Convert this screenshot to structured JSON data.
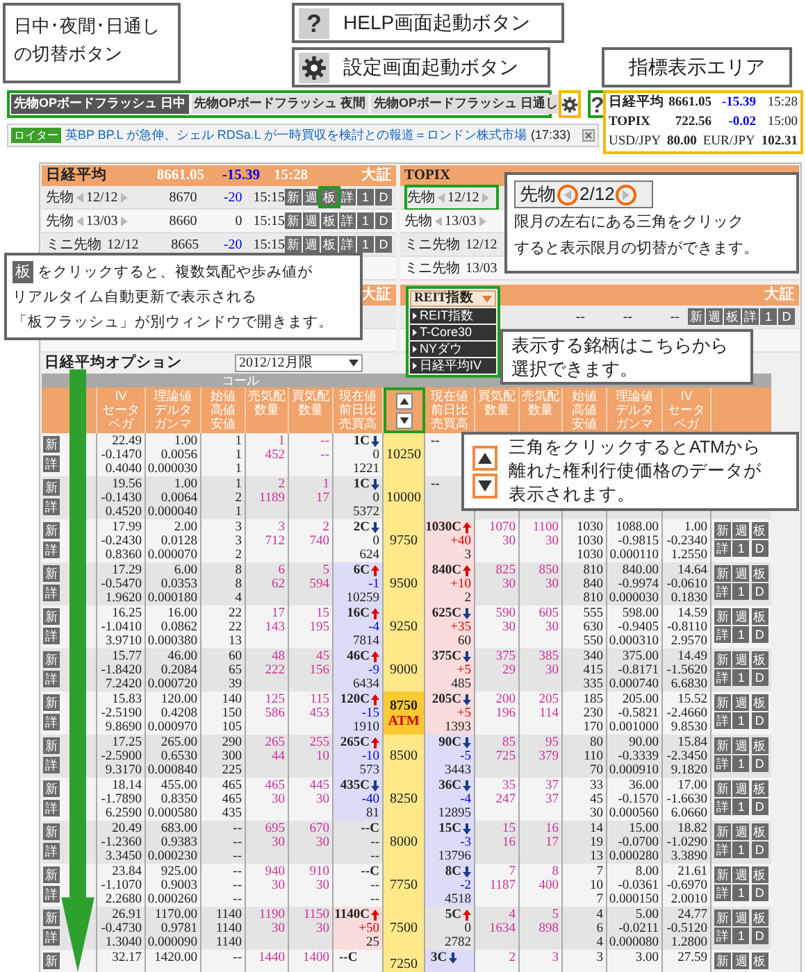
{
  "callouts": {
    "tab_switch": [
      "日中･夜間･日通し",
      "の切替ボタン"
    ],
    "help": {
      "icon": "?",
      "text": "HELP画面起動ボタン"
    },
    "settings": "設定画面起動ボタン",
    "indicators": "指標表示エリア",
    "board": {
      "badge": "板",
      "lines": [
        "をクリックすると、複数気配や歩み値が",
        "リアルタイム自動更新で表示される",
        "「板フラッシュ」が別ウィンドウで開きます。"
      ]
    },
    "month": {
      "label": "先物",
      "month": "2/12",
      "lines": [
        "限月の左右にある三角をクリック",
        "すると表示限月の切替ができます。"
      ]
    },
    "symbol": [
      "表示する銘柄はこちらから",
      "選択できます。"
    ],
    "strike": [
      "三角をクリックするとATMから",
      "離れた権利行使価格のデータが",
      "表示されます。"
    ]
  },
  "tabs_bar": {
    "highlighted": true,
    "color": "#1e9e1e",
    "tabs": [
      {
        "label": "先物OPボードフラッシュ 日中",
        "selected": true
      },
      {
        "label": "先物OPボードフラッシュ 夜間",
        "selected": false
      },
      {
        "label": "先物OPボードフラッシュ 日通し",
        "selected": false
      }
    ]
  },
  "settings_button": {
    "highlighted": true,
    "color": "#f5b800"
  },
  "help_button": {
    "label": "?",
    "highlighted": true,
    "color": "#1e9e1e"
  },
  "indicator_panel": {
    "highlighted": true,
    "color": "#f5b800",
    "indices": [
      {
        "name": "日経平均",
        "value": "8661.05",
        "change": "-15.39",
        "time": "15:28"
      },
      {
        "name": "TOPIX",
        "value": "722.56",
        "change": "-0.02",
        "time": "15:00"
      }
    ],
    "fx": [
      {
        "pair": "USD/JPY",
        "value": "80.00"
      },
      {
        "pair": "EUR/JPY",
        "value": "102.31"
      }
    ]
  },
  "news": {
    "source": "ロイター",
    "headline": "英BP BP.L が急伸、シェル RDSa.L が一時買収を検討との報道＝ロンドン株式市場",
    "time": "(17:33)"
  },
  "nikkei_panel": {
    "header": {
      "name": "日経平均",
      "value": "8661.05",
      "change": "-15.39",
      "time": "15:28",
      "exchange": "大証"
    },
    "rows": [
      {
        "name": "先物",
        "month": "12/12",
        "price": "8670",
        "change": "-20",
        "time": "15:15",
        "buttons": [
          "新",
          "週",
          "板",
          "詳",
          "1",
          "D"
        ],
        "highlighted": true,
        "color": "#1e9e1e"
      },
      {
        "name": "先物",
        "month": "13/03",
        "price": "8660",
        "change": "0",
        "time": "15:15",
        "buttons": [
          "新",
          "週",
          "板",
          "詳",
          "1",
          "D"
        ],
        "highlighted": false
      },
      {
        "name": "ミニ先物",
        "month": "12/12",
        "price": "8665",
        "change": "-20",
        "time": "15:15",
        "buttons": [
          "新",
          "週",
          "板",
          "詳",
          "1",
          "D"
        ],
        "highlighted": false
      }
    ]
  },
  "nikkei_panel_2": {
    "exchange": "大証"
  },
  "topix_panel": {
    "header": {
      "name": "TOPIX"
    },
    "rows": [
      {
        "name": "先物",
        "month": "12/12",
        "highlighted": true,
        "color": "#1e9e1e"
      },
      {
        "name": "先物",
        "month": "13/03",
        "highlighted": false
      },
      {
        "name": "ミニ先物",
        "month": "12/12",
        "highlighted": false
      },
      {
        "name": "ミニ先物",
        "month": "13/03",
        "highlighted": false
      }
    ]
  },
  "reit_panel": {
    "dropdown": "REIT指数",
    "highlighted": true,
    "color": "#1e9e1e",
    "menu": [
      "REIT指数",
      "T-Core30",
      "NYダウ",
      "日経平均IV"
    ],
    "exchange": "大証",
    "values": [
      "--",
      "--",
      "--"
    ],
    "buttons": [
      "新",
      "週",
      "板",
      "詳",
      "1",
      "D"
    ]
  },
  "options": {
    "title": "日経平均オプション",
    "month_select": "2012/12月限",
    "call_header": "コール",
    "strike_nav": {
      "highlighted": true,
      "color": "#1e9e1e"
    },
    "call_columns": [
      [
        "IV",
        "セータ",
        "ベガ"
      ],
      [
        "理論値",
        "デルタ",
        "ガンマ"
      ],
      [
        "始値",
        "高値",
        "安値"
      ],
      [
        "売気配",
        "数量"
      ],
      [
        "買気配",
        "数量"
      ],
      [
        "現在値",
        "前日比",
        "売買高"
      ]
    ],
    "put_columns": [
      [
        "現在値",
        "前日比",
        "売買高"
      ],
      [
        "買気配",
        "数量"
      ],
      [
        "売気配",
        "数量"
      ],
      [
        "始値",
        "高値",
        "安値"
      ],
      [
        "理論値",
        "デルタ",
        "ガンマ"
      ],
      [
        "IV",
        "セータ",
        "ベガ"
      ]
    ],
    "rows": [
      {
        "strike": "10250",
        "atm": false,
        "call_buttons": [
          "新",
          "詳"
        ],
        "call": {
          "iv": [
            "22.49",
            "-0.1470",
            "0.4040"
          ],
          "theo": [
            "1.00",
            "0.0056",
            "0.000030"
          ],
          "ohl": [
            "1",
            "1",
            "1"
          ],
          "ask": [
            "1",
            "452"
          ],
          "bid": [
            "--",
            "--"
          ],
          "cur": {
            "price": "1C",
            "kind": "down",
            "change": "0",
            "volume": "1221"
          }
        },
        "put": {
          "cur": {
            "price": "--"
          }
        }
      },
      {
        "strike": "10000",
        "atm": false,
        "call_buttons": [
          "新",
          "詳"
        ],
        "call": {
          "iv": [
            "19.56",
            "-0.1430",
            "0.4520"
          ],
          "theo": [
            "1.00",
            "0.0064",
            "0.000040"
          ],
          "ohl": [
            "1",
            "2",
            "1"
          ],
          "ask": [
            "2",
            "1189"
          ],
          "bid": [
            "1",
            "17"
          ],
          "cur": {
            "price": "1C",
            "kind": "down",
            "change": "0",
            "volume": "5372"
          }
        },
        "put": {
          "cur": {
            "price": "--"
          }
        }
      },
      {
        "strike": "9750",
        "atm": false,
        "call_buttons": [
          "新",
          "詳"
        ],
        "put_buttons": [
          "新",
          "週",
          "板",
          "詳",
          "1",
          "D"
        ],
        "call": {
          "iv": [
            "17.99",
            "-0.2430",
            "0.8360"
          ],
          "theo": [
            "2.00",
            "0.0128",
            "0.000070"
          ],
          "ohl": [
            "3",
            "3",
            "2"
          ],
          "ask": [
            "3",
            "712"
          ],
          "bid": [
            "2",
            "740"
          ],
          "cur": {
            "price": "2C",
            "kind": "down",
            "change": "0",
            "volume": "624"
          }
        },
        "put": {
          "cur": {
            "price": "1030C",
            "kind": "up",
            "change": "+40",
            "volume": "3",
            "color": "#fadcdc"
          },
          "bid": [
            "1070",
            "30"
          ],
          "ask": [
            "1100",
            "30"
          ],
          "ohl": [
            "1030",
            "1030",
            "1030"
          ],
          "theo": [
            "1088.00",
            "-0.9815",
            "0.000110"
          ],
          "iv": [
            "1.00",
            "-0.2340",
            "1.2550"
          ]
        }
      },
      {
        "strike": "9500",
        "atm": false,
        "call_buttons": [
          "新",
          "詳"
        ],
        "put_buttons": [
          "新",
          "週",
          "板",
          "詳",
          "1",
          "D"
        ],
        "call": {
          "iv": [
            "17.29",
            "-0.5470",
            "1.9620"
          ],
          "theo": [
            "6.00",
            "0.0353",
            "0.000180"
          ],
          "ohl": [
            "8",
            "8",
            "4"
          ],
          "ask": [
            "6",
            "62"
          ],
          "bid": [
            "5",
            "594"
          ],
          "cur": {
            "price": "6C",
            "kind": "up",
            "change": "-1",
            "volume": "10259",
            "color": "#dcdcf8"
          }
        },
        "put": {
          "cur": {
            "price": "840C",
            "kind": "up",
            "change": "+10",
            "volume": "2",
            "color": "#fadcdc"
          },
          "bid": [
            "825",
            "30"
          ],
          "ask": [
            "850",
            "30"
          ],
          "ohl": [
            "810",
            "840",
            "810"
          ],
          "theo": [
            "840.00",
            "-0.9974",
            "0.000030"
          ],
          "iv": [
            "14.64",
            "-0.0610",
            "0.1830"
          ]
        }
      },
      {
        "strike": "9250",
        "atm": false,
        "call_buttons": [
          "新",
          "詳"
        ],
        "put_buttons": [
          "新",
          "週",
          "板",
          "詳",
          "1",
          "D"
        ],
        "call": {
          "iv": [
            "16.25",
            "-1.0410",
            "3.9710"
          ],
          "theo": [
            "16.00",
            "0.0862",
            "0.000380"
          ],
          "ohl": [
            "22",
            "22",
            "13"
          ],
          "ask": [
            "17",
            "143"
          ],
          "bid": [
            "15",
            "195"
          ],
          "cur": {
            "price": "16C",
            "kind": "up",
            "change": "-4",
            "volume": "7814",
            "color": "#dcdcf8"
          }
        },
        "put": {
          "cur": {
            "price": "625C",
            "kind": "down",
            "change": "+35",
            "volume": "60",
            "color": "#fadcdc"
          },
          "bid": [
            "590",
            "30"
          ],
          "ask": [
            "605",
            "30"
          ],
          "ohl": [
            "555",
            "630",
            "550"
          ],
          "theo": [
            "598.00",
            "-0.9405",
            "0.000310"
          ],
          "iv": [
            "14.59",
            "-0.8110",
            "2.9570"
          ]
        }
      },
      {
        "strike": "9000",
        "atm": false,
        "call_buttons": [
          "新",
          "詳"
        ],
        "put_buttons": [
          "新",
          "週",
          "板",
          "詳",
          "1",
          "D"
        ],
        "call": {
          "iv": [
            "15.77",
            "-1.8420",
            "7.2420"
          ],
          "theo": [
            "46.00",
            "0.2084",
            "0.000720"
          ],
          "ohl": [
            "60",
            "65",
            "39"
          ],
          "ask": [
            "48",
            "222"
          ],
          "bid": [
            "45",
            "156"
          ],
          "cur": {
            "price": "46C",
            "kind": "up",
            "change": "-9",
            "volume": "6434",
            "color": "#dcdcf8"
          }
        },
        "put": {
          "cur": {
            "price": "375C",
            "kind": "down",
            "change": "+5",
            "volume": "485",
            "color": "#fadcdc"
          },
          "bid": [
            "375",
            "29"
          ],
          "ask": [
            "385",
            "30"
          ],
          "ohl": [
            "340",
            "415",
            "335"
          ],
          "theo": [
            "375.00",
            "-0.8171",
            "0.000740"
          ],
          "iv": [
            "14.49",
            "-1.5620",
            "6.6830"
          ]
        }
      },
      {
        "strike": "8750",
        "atm": true,
        "atm_label": "ATM",
        "call_buttons": [
          "新",
          "詳"
        ],
        "put_buttons": [
          "新",
          "週",
          "板",
          "詳",
          "1",
          "D"
        ],
        "call": {
          "iv": [
            "15.83",
            "-2.5190",
            "9.8690"
          ],
          "theo": [
            "120.00",
            "0.4208",
            "0.000970"
          ],
          "ohl": [
            "140",
            "150",
            "105"
          ],
          "ask": [
            "125",
            "586"
          ],
          "bid": [
            "115",
            "453"
          ],
          "cur": {
            "price": "120C",
            "kind": "up",
            "change": "-15",
            "volume": "1910",
            "color": "#dcdcf8"
          }
        },
        "put": {
          "cur": {
            "price": "205C",
            "kind": "down",
            "change": "+5",
            "volume": "1393",
            "color": "#fadcdc"
          },
          "bid": [
            "200",
            "196"
          ],
          "ask": [
            "205",
            "114"
          ],
          "ohl": [
            "185",
            "230",
            "170"
          ],
          "theo": [
            "205.00",
            "-0.5821",
            "0.001000"
          ],
          "iv": [
            "15.52",
            "-2.4660",
            "9.8530"
          ]
        }
      },
      {
        "strike": "8500",
        "atm": false,
        "call_buttons": [
          "新",
          "詳"
        ],
        "put_buttons": [
          "新",
          "週",
          "板",
          "詳",
          "1",
          "D"
        ],
        "call": {
          "iv": [
            "17.25",
            "-2.5900",
            "9.3170"
          ],
          "theo": [
            "265.00",
            "0.6530",
            "0.000840"
          ],
          "ohl": [
            "290",
            "300",
            "225"
          ],
          "ask": [
            "265",
            "44"
          ],
          "bid": [
            "255",
            "10"
          ],
          "cur": {
            "price": "265C",
            "kind": "up",
            "change": "-10",
            "volume": "573",
            "color": "#dcdcf8"
          }
        },
        "put": {
          "cur": {
            "price": "90C",
            "kind": "down",
            "change": "-5",
            "volume": "3443",
            "color": "#dcdcf8"
          },
          "bid": [
            "85",
            "725"
          ],
          "ask": [
            "95",
            "379"
          ],
          "ohl": [
            "80",
            "110",
            "70"
          ],
          "theo": [
            "90.00",
            "-0.3339",
            "0.000910"
          ],
          "iv": [
            "15.84",
            "-2.3450",
            "9.1820"
          ]
        }
      },
      {
        "strike": "8250",
        "atm": false,
        "call_buttons": [
          "新",
          "詳"
        ],
        "put_buttons": [
          "新",
          "週",
          "板",
          "詳",
          "1",
          "D"
        ],
        "call": {
          "iv": [
            "18.14",
            "-1.7890",
            "6.2590"
          ],
          "theo": [
            "455.00",
            "0.8350",
            "0.000580"
          ],
          "ohl": [
            "465",
            "465",
            "435"
          ],
          "ask": [
            "465",
            "30"
          ],
          "bid": [
            "445",
            "30"
          ],
          "cur": {
            "price": "435C",
            "kind": "down",
            "change": "-40",
            "volume": "81",
            "color": "#dcdcf8"
          }
        },
        "put": {
          "cur": {
            "price": "36C",
            "kind": "down",
            "change": "-4",
            "volume": "12895",
            "color": "#dcdcf8"
          },
          "bid": [
            "35",
            "247"
          ],
          "ask": [
            "37",
            "37"
          ],
          "ohl": [
            "33",
            "45",
            "30"
          ],
          "theo": [
            "36.00",
            "-0.1570",
            "0.000560"
          ],
          "iv": [
            "17.00",
            "-1.6630",
            "6.0660"
          ]
        }
      },
      {
        "strike": "8000",
        "atm": false,
        "call_buttons": [
          "新",
          "詳"
        ],
        "put_buttons": [
          "新",
          "週",
          "板",
          "詳",
          "1",
          "D"
        ],
        "call": {
          "iv": [
            "20.49",
            "-1.2360",
            "3.3450"
          ],
          "theo": [
            "683.00",
            "0.9383",
            "0.000230"
          ],
          "ohl": [
            "--",
            "--",
            "--"
          ],
          "ask": [
            "695",
            "30"
          ],
          "bid": [
            "670",
            "30"
          ],
          "cur": {
            "price": "--C",
            "kind": "none",
            "change": "--",
            "volume": "--"
          }
        },
        "put": {
          "cur": {
            "price": "15C",
            "kind": "down",
            "change": "-3",
            "volume": "13796",
            "color": "#dcdcf8"
          },
          "bid": [
            "15",
            "16"
          ],
          "ask": [
            "16",
            "17"
          ],
          "ohl": [
            "14",
            "19",
            "13"
          ],
          "theo": [
            "15.00",
            "-0.0700",
            "0.000280"
          ],
          "iv": [
            "18.82",
            "-1.0290",
            "3.3890"
          ]
        }
      },
      {
        "strike": "7750",
        "atm": false,
        "call_buttons": [
          "新",
          "詳"
        ],
        "put_buttons": [
          "新",
          "週",
          "板",
          "詳",
          "1",
          "D"
        ],
        "call": {
          "iv": [
            "23.84",
            "-1.1070",
            "2.2680"
          ],
          "theo": [
            "925.00",
            "0.9003",
            "0.000260"
          ],
          "ohl": [
            "--",
            "--",
            "--"
          ],
          "ask": [
            "940",
            "30"
          ],
          "bid": [
            "910",
            "30"
          ],
          "cur": {
            "price": "--C",
            "kind": "none",
            "change": "--",
            "volume": "--"
          }
        },
        "put": {
          "cur": {
            "price": "8C",
            "kind": "down",
            "change": "-2",
            "volume": "4518",
            "color": "#dcdcf8"
          },
          "bid": [
            "7",
            "1187"
          ],
          "ask": [
            "8",
            "400"
          ],
          "ohl": [
            "7",
            "10",
            "7"
          ],
          "theo": [
            "8.00",
            "-0.0361",
            "0.000150"
          ],
          "iv": [
            "21.61",
            "-0.6970",
            "2.0010"
          ]
        }
      },
      {
        "strike": "7500",
        "atm": false,
        "call_buttons": [
          "新",
          "詳"
        ],
        "put_buttons": [
          "新",
          "週",
          "板",
          "詳",
          "1",
          "D"
        ],
        "call": {
          "iv": [
            "26.91",
            "-0.4730",
            "1.3040"
          ],
          "theo": [
            "1170.00",
            "0.9781",
            "0.000090"
          ],
          "ohl": [
            "1140",
            "1140",
            "1140"
          ],
          "ask": [
            "1190",
            "30"
          ],
          "bid": [
            "1150",
            "30"
          ],
          "cur": {
            "price": "1140C",
            "kind": "up",
            "change": "+50",
            "volume": "25",
            "color": "#fadcdc"
          }
        },
        "put": {
          "cur": {
            "price": "5C",
            "kind": "up",
            "change": "0",
            "volume": "2782"
          },
          "bid": [
            "4",
            "1634"
          ],
          "ask": [
            "5",
            "898"
          ],
          "ohl": [
            "4",
            "6",
            "4"
          ],
          "theo": [
            "5.00",
            "-0.0211",
            "0.000080"
          ],
          "iv": [
            "24.77",
            "-0.5120",
            "1.2800"
          ]
        }
      },
      {
        "strike": "7250",
        "atm": false,
        "call_buttons": [
          "新"
        ],
        "put_buttons": [
          "新",
          "週",
          "板"
        ],
        "call": {
          "iv": [
            "32.17"
          ],
          "theo": [
            "1420.00"
          ],
          "ohl": [
            "--"
          ],
          "ask": [
            "1440"
          ],
          "bid": [
            "1400"
          ],
          "cur": {
            "price": "--C",
            "kind": "none"
          }
        },
        "put": {
          "cur": {
            "price": "3C",
            "kind": "down",
            "color": "#dcdcf8"
          },
          "bid": [
            "2"
          ],
          "ask": [
            "3"
          ],
          "ohl": [
            "3"
          ],
          "theo": [
            "3.00"
          ],
          "iv": [
            "27.59"
          ]
        }
      }
    ]
  }
}
